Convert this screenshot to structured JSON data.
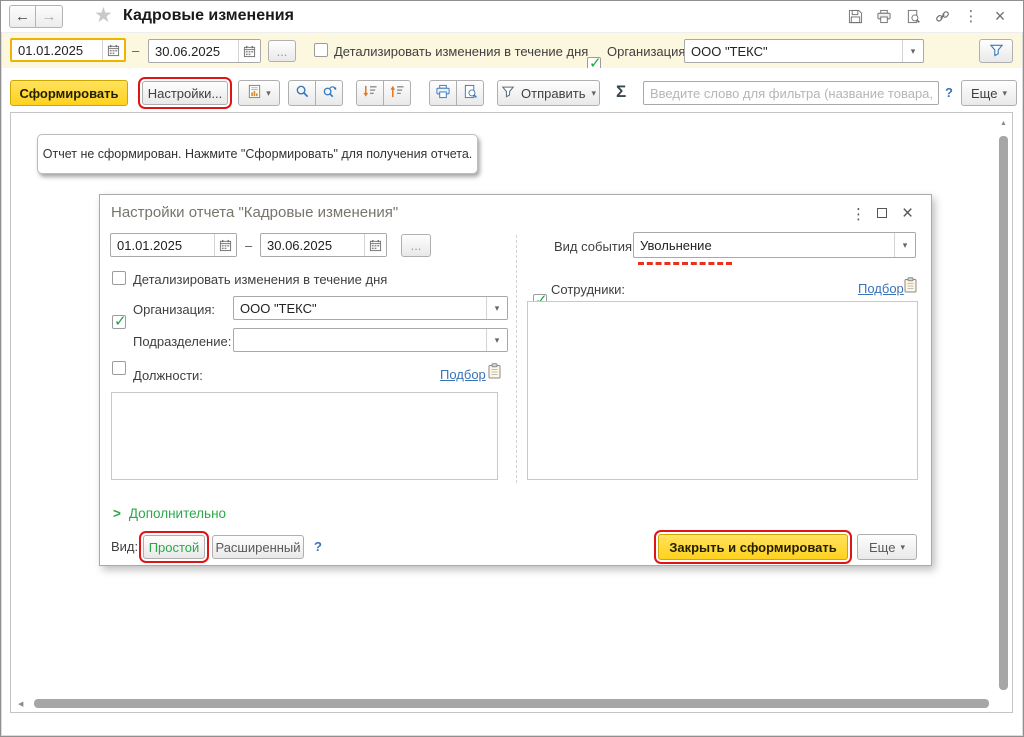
{
  "titlebar": {
    "title": "Кадровые изменения"
  },
  "filter_bar": {
    "date_from": "01.01.2025",
    "date_to": "30.06.2025",
    "detail_label": "Детализировать изменения в течение дня",
    "org_label": "Организация:",
    "org_value": "ООО \"ТЕКС\""
  },
  "toolbar": {
    "generate_label": "Сформировать",
    "settings_label": "Настройки...",
    "send_label": "Отправить",
    "sigma_label": "Σ",
    "search_placeholder": "Введите слово для фильтра (название товара, поку...",
    "help_label": "?",
    "more_label": "Еще"
  },
  "message": {
    "text": "Отчет не сформирован. Нажмите \"Сформировать\" для получения отчета."
  },
  "dialog": {
    "title": "Настройки отчета \"Кадровые изменения\"",
    "date_from": "01.01.2025",
    "date_to": "30.06.2025",
    "detail_label": "Детализировать изменения в течение дня",
    "org_label": "Организация:",
    "org_value": "ООО \"ТЕКС\"",
    "department_label": "Подразделение:",
    "positions_label": "Должности:",
    "positions_pick_label": "Подбор",
    "event_type_label": "Вид события:",
    "event_type_value": "Увольнение",
    "employees_label": "Сотрудники:",
    "employees_pick_label": "Подбор",
    "additional_label": "Дополнительно",
    "view_label": "Вид:",
    "view_simple_label": "Простой",
    "view_extended_label": "Расширенный",
    "help_label": "?",
    "close_generate_label": "Закрыть и сформировать",
    "more_label": "Еще"
  },
  "icons": {
    "back": "←",
    "forward": "→",
    "star": "★",
    "window_menu": "⋮",
    "window_close": "×",
    "dialog_menu": "⋮",
    "dialog_close": "×",
    "dropdown": "▾",
    "dash": "–",
    "ellipsis": "...",
    "chevron_right": ">",
    "scroll_up": "▲",
    "scroll_left": "◀"
  },
  "colors": {
    "accent_yellow": "#ffd633",
    "focus_border": "#f0b400",
    "annotation_red": "#e01414",
    "link_blue": "#3b73b9",
    "green": "#2ba84a",
    "filter_bar_bg": "#fcf7df"
  }
}
